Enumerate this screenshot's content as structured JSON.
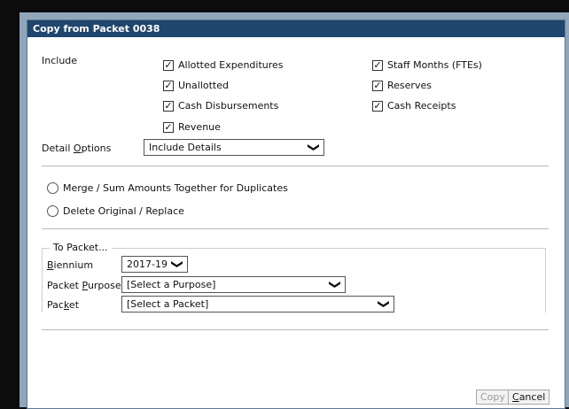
{
  "dialog": {
    "title": "Copy from Packet 0038",
    "include_label": "Include",
    "checkboxes": [
      {
        "label": "Allotted Expenditures",
        "checked": true
      },
      {
        "label": "Unallotted",
        "checked": true
      },
      {
        "label": "Cash Disbursements",
        "checked": true
      },
      {
        "label": "Revenue",
        "checked": true
      },
      {
        "label": "Staff Months (FTEs)",
        "checked": true
      },
      {
        "label": "Reserves",
        "checked": true
      },
      {
        "label": "Cash Receipts",
        "checked": true
      }
    ],
    "check_mark": "✓",
    "chevron": "❯",
    "detail_options": {
      "label_before": "Detail ",
      "label_key": "O",
      "label_after": "ptions",
      "value": "Include Details"
    },
    "radios": [
      {
        "label": "Merge / Sum Amounts Together for Duplicates",
        "selected": false
      },
      {
        "label": "Delete Original / Replace",
        "selected": false
      }
    ],
    "to_packet": {
      "legend": "To Packet...",
      "biennium": {
        "label_key": "B",
        "label_after": "iennium",
        "value": "2017-19"
      },
      "purpose": {
        "label_before": "Packet ",
        "label_key": "P",
        "label_after": "urpose",
        "value": "[Select a Purpose]"
      },
      "packet": {
        "label_before": "Pac",
        "label_key": "k",
        "label_after": "et",
        "value": "[Select a Packet]"
      }
    },
    "buttons": {
      "copy": "Copy",
      "cancel_key": "C",
      "cancel_rest": "ancel"
    }
  }
}
